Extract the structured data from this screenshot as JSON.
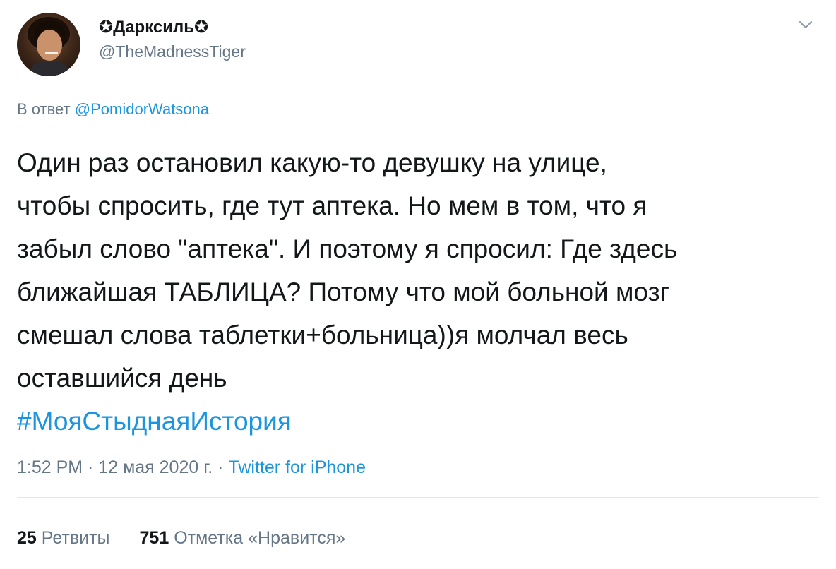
{
  "author": {
    "display_name": "✪Дарксиль✪",
    "username": "@TheMadnessTiger"
  },
  "icons": {
    "avatar": "user-avatar-photo",
    "more": "chevron-down-icon"
  },
  "reply": {
    "prefix": "В ответ",
    "mention": "@PomidorWatsona"
  },
  "tweet": {
    "lines": [
      "Один раз остановил какую-то девушку на улице,",
      "чтобы спросить, где тут аптека. Но мем в том, что я",
      "забыл слово \"аптека\". И поэтому я спросил: Где здесь",
      "ближайшая ТАБЛИЦА? Потому что мой больной мозг",
      "смешал слова таблетки+больница))я молчал весь",
      "оставшийся день"
    ],
    "hashtag": "#МояСтыднаяИстория"
  },
  "meta": {
    "time": "1:52 PM",
    "sep1": " · ",
    "date": "12 мая 2020 г.",
    "sep2": " · ",
    "source": "Twitter for iPhone"
  },
  "stats": {
    "retweets_count": "25",
    "retweets_label": "Ретвиты",
    "likes_count": "751",
    "likes_label": "Отметка «Нравится»"
  },
  "colors": {
    "link": "#1b95e0",
    "secondary_text": "#657786",
    "primary_text": "#14171a",
    "divider": "#e1e8ed"
  }
}
